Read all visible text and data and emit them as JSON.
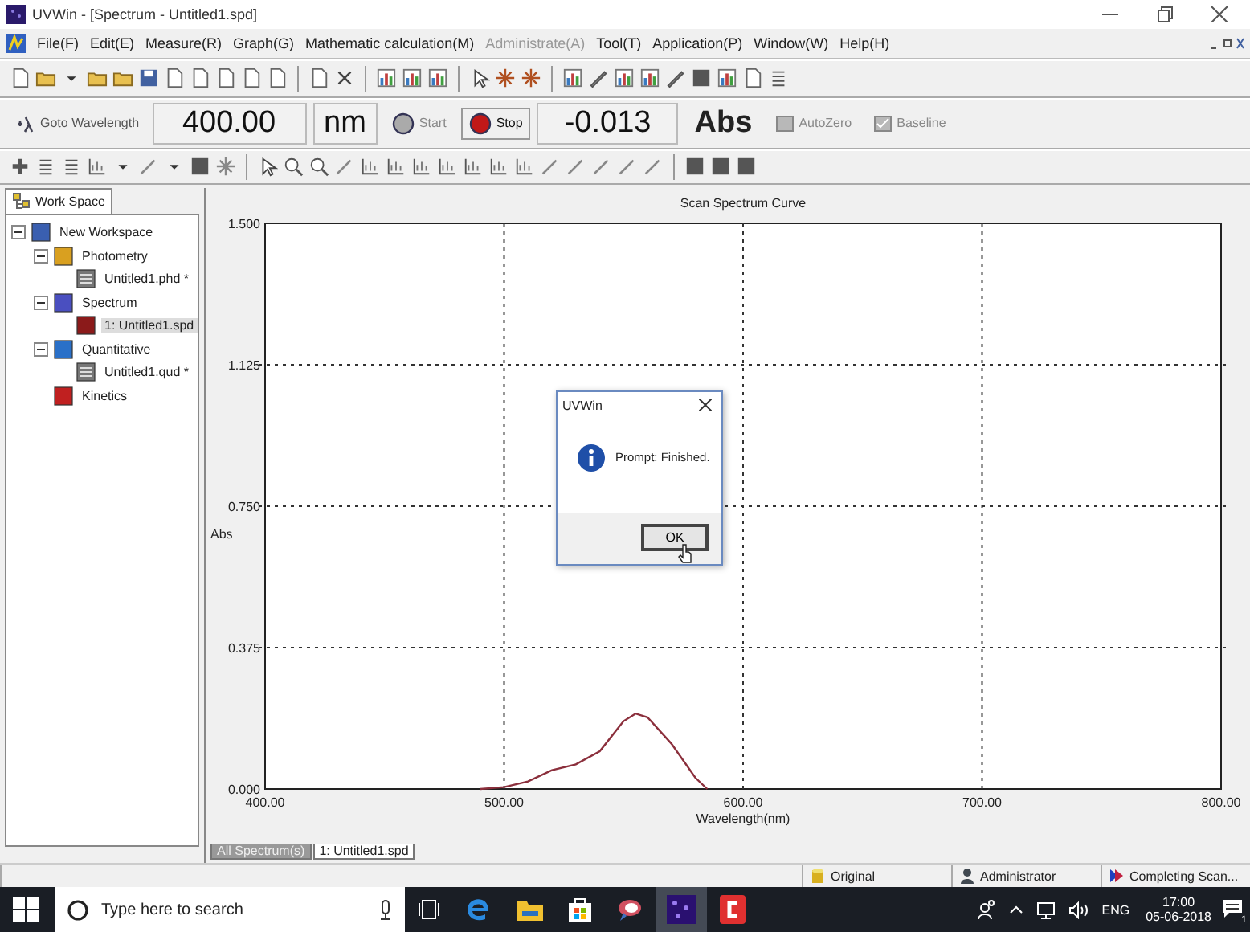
{
  "window": {
    "title": "UVWin - [Spectrum - Untitled1.spd]"
  },
  "menu": [
    {
      "label": "File(F)",
      "disabled": false
    },
    {
      "label": "Edit(E)",
      "disabled": false
    },
    {
      "label": "Measure(R)",
      "disabled": false
    },
    {
      "label": "Graph(G)",
      "disabled": false
    },
    {
      "label": "Mathematic calculation(M)",
      "disabled": false
    },
    {
      "label": "Administrate(A)",
      "disabled": true
    },
    {
      "label": "Tool(T)",
      "disabled": false
    },
    {
      "label": "Application(P)",
      "disabled": false
    },
    {
      "label": "Window(W)",
      "disabled": false
    },
    {
      "label": "Help(H)",
      "disabled": false
    }
  ],
  "measure_bar": {
    "goto": "Goto Wavelength",
    "wavelength": "400.00",
    "wavelength_unit": "nm",
    "controls": [
      {
        "label": "Start",
        "kind": "start",
        "disabled": true
      },
      {
        "label": "Stop",
        "kind": "stop",
        "disabled": false
      }
    ],
    "reading": "-0.013",
    "reading_unit": "Abs",
    "actions": [
      {
        "label": "AutoZero",
        "kind": "autozero",
        "disabled": true
      },
      {
        "label": "Baseline",
        "kind": "baseline",
        "disabled": true
      }
    ]
  },
  "workspace": {
    "tab": "Work Space",
    "tree": [
      {
        "label": "New Workspace",
        "kind": "workspace",
        "expanded": true,
        "selected": false,
        "children": [
          {
            "label": "Photometry",
            "kind": "photometry",
            "expanded": true,
            "selected": false,
            "children": [
              {
                "label": "Untitled1.phd *",
                "kind": "file",
                "selected": false
              }
            ]
          },
          {
            "label": "Spectrum",
            "kind": "spectrum",
            "expanded": true,
            "selected": false,
            "children": [
              {
                "label": "1: Untitled1.spd",
                "kind": "spectrum-file",
                "selected": true
              }
            ]
          },
          {
            "label": "Quantitative",
            "kind": "quantitative",
            "expanded": true,
            "selected": false,
            "children": [
              {
                "label": "Untitled1.qud *",
                "kind": "file",
                "selected": false
              }
            ]
          },
          {
            "label": "Kinetics",
            "kind": "kinetics",
            "selected": false
          }
        ]
      }
    ]
  },
  "chart": {
    "chart_data": {
      "type": "line",
      "grid": true,
      "title": "Scan Spectrum Curve",
      "xlabel": "Wavelength(nm)",
      "ylabel": "Abs",
      "xlim": [
        400,
        800
      ],
      "ylim": [
        0,
        1.5
      ],
      "xticks": [
        {
          "value": 400,
          "label": "400.00"
        },
        {
          "value": 500,
          "label": "500.00"
        },
        {
          "value": 600,
          "label": "600.00"
        },
        {
          "value": 700,
          "label": "700.00"
        },
        {
          "value": 800,
          "label": "800.00"
        }
      ],
      "yticks": [
        {
          "value": 0,
          "label": "0.000"
        },
        {
          "value": 0.375,
          "label": "0.375"
        },
        {
          "value": 0.75,
          "label": "0.750"
        },
        {
          "value": 1.125,
          "label": "1.125"
        },
        {
          "value": 1.5,
          "label": "1.500"
        }
      ],
      "x": [
        490,
        500,
        510,
        520,
        530,
        540,
        550,
        555,
        560,
        570,
        580,
        585
      ],
      "series": [
        {
          "color": "#8b2f3c",
          "values": [
            0,
            0.005,
            0.02,
            0.05,
            0.065,
            0.1,
            0.18,
            0.2,
            0.19,
            0.12,
            0.03,
            0
          ]
        }
      ]
    }
  },
  "doc_tabs": [
    {
      "label": "All Spectrum(s)",
      "selected": false
    },
    {
      "label": "1: Untitled1.spd",
      "selected": true
    }
  ],
  "dialog": {
    "title": "UVWin",
    "message": "Prompt: Finished.",
    "button": "OK"
  },
  "status_bar": [
    {
      "text": "Original",
      "kind": "database"
    },
    {
      "text": "Administrator",
      "kind": "user"
    },
    {
      "text": "Completing Scan...",
      "kind": "scan"
    }
  ],
  "taskbar": {
    "search_placeholder": "Type here to search",
    "language": "ENG",
    "time": "17:00",
    "date": "05-06-2018",
    "notifications": "1"
  }
}
